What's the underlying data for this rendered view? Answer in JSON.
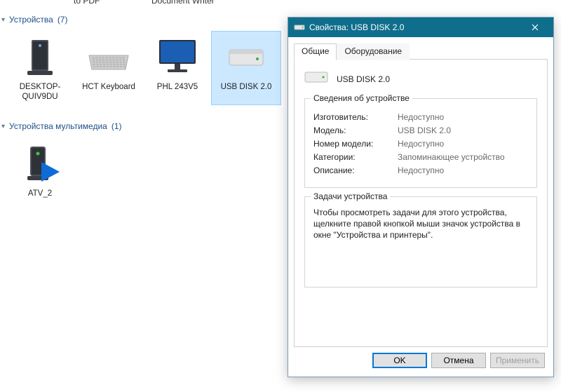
{
  "fragments": {
    "t1": "to PDF",
    "t2": "Document Writer"
  },
  "groups": {
    "devices": {
      "label": "Устройства",
      "count_text": "(7)"
    },
    "media": {
      "label": "Устройства мультимедиа",
      "count_text": "(1)"
    }
  },
  "devices_row": [
    {
      "label": "DESKTOP-QUIV9DU",
      "kind": "pc"
    },
    {
      "label": "HCT Keyboard",
      "kind": "keyboard"
    },
    {
      "label": "PHL 243V5",
      "kind": "monitor"
    },
    {
      "label": "USB DISK 2.0",
      "kind": "drive",
      "selected": true
    }
  ],
  "media_row": [
    {
      "label": "ATV_2",
      "kind": "mediaserver"
    }
  ],
  "props": {
    "title": "Свойства: USB DISK 2.0",
    "tabs": {
      "general": "Общие",
      "hardware": "Оборудование"
    },
    "device_name": "USB DISK 2.0",
    "section_info_title": "Сведения об устройстве",
    "fields": {
      "manufacturer": {
        "k": "Изготовитель:",
        "v": "Недоступно"
      },
      "model": {
        "k": "Модель:",
        "v": "USB DISK 2.0"
      },
      "model_number": {
        "k": "Номер модели:",
        "v": "Недоступно"
      },
      "categories": {
        "k": "Категории:",
        "v": "Запоминающее устройство"
      },
      "description": {
        "k": "Описание:",
        "v": "Недоступно"
      }
    },
    "section_tasks_title": "Задачи устройства",
    "tasks_text": "Чтобы просмотреть задачи для этого устройства, щелкните правой кнопкой мыши значок устройства в окне \"Устройства и принтеры\".",
    "buttons": {
      "ok": "OK",
      "cancel": "Отмена",
      "apply": "Применить"
    }
  }
}
